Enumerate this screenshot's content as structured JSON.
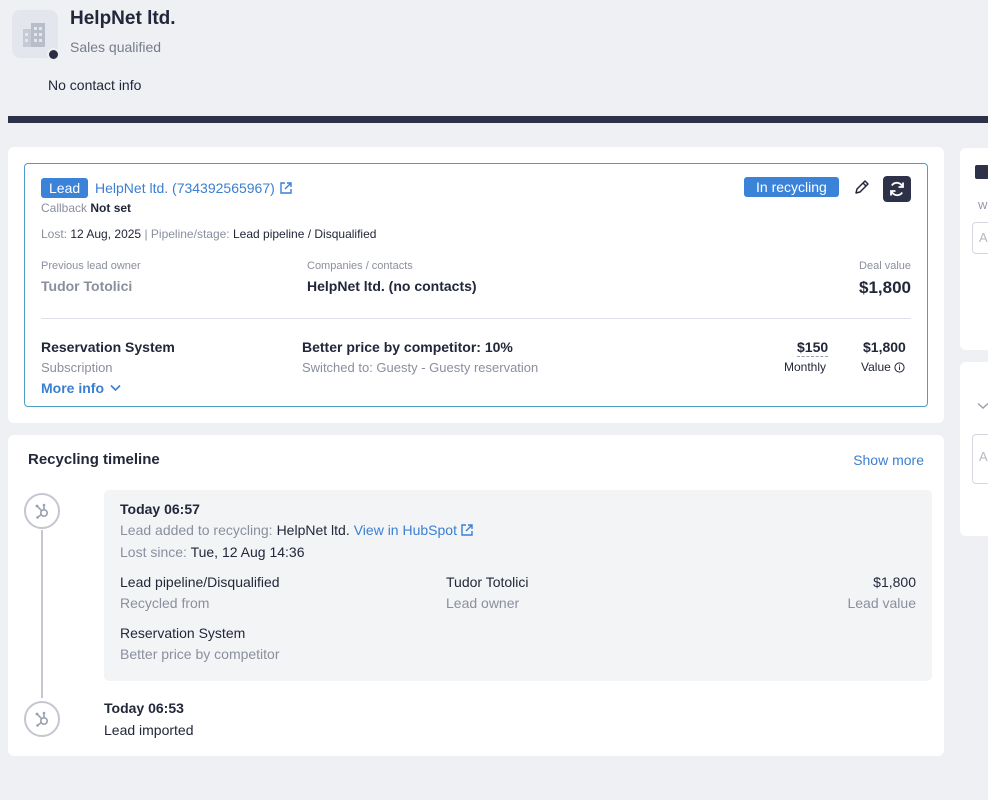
{
  "header": {
    "company_name": "HelpNet ltd.",
    "stage": "Sales qualified",
    "contact_info": "No contact info"
  },
  "lead": {
    "badge": "Lead",
    "link_text": "HelpNet ltd. (734392565967)",
    "callback_label": "Callback",
    "callback_value": "Not set",
    "lost_label": "Lost:",
    "lost_value": "12 Aug, 2025",
    "separator": "|",
    "pipeline_label": "Pipeline/stage:",
    "pipeline_value": "Lead pipeline / Disqualified",
    "status_badge": "In recycling",
    "previous_owner_label": "Previous lead owner",
    "previous_owner": "Tudor Totolici",
    "companies_label": "Companies / contacts",
    "companies_value": "HelpNet ltd. (no contacts)",
    "deal_value_label": "Deal value",
    "deal_value": "$1,800",
    "product_name": "Reservation System",
    "product_type": "Subscription",
    "reason": "Better price by competitor: 10%",
    "switched_to": "Switched to: Guesty - Guesty reservation",
    "monthly_value": "$150",
    "monthly_label": "Monthly",
    "total_value": "$1,800",
    "value_label": "Value",
    "more_info": "More info"
  },
  "timeline": {
    "title": "Recycling timeline",
    "show_more": "Show more",
    "events": [
      {
        "time": "Today 06:57",
        "added_label": "Lead added to recycling:",
        "added_value": "HelpNet ltd.",
        "hubspot_link": "View in HubSpot",
        "lost_since_label": "Lost since:",
        "lost_since_value": "Tue, 12 Aug 14:36",
        "pipeline": "Lead pipeline/Disqualified",
        "pipeline_label": "Recycled from",
        "owner": "Tudor Totolici",
        "owner_label": "Lead owner",
        "value": "$1,800",
        "value_label": "Lead value",
        "product": "Reservation System",
        "reason": "Better price by competitor"
      },
      {
        "time": "Today 06:53",
        "text": "Lead imported"
      }
    ]
  },
  "side_panel": {
    "label_w": "W",
    "input1_placeholder": "A",
    "input2_placeholder": "A"
  },
  "colors": {
    "accent": "#3b82d9",
    "link": "#3a7fd1",
    "dark": "#2d3249",
    "background": "#eef0f3"
  }
}
